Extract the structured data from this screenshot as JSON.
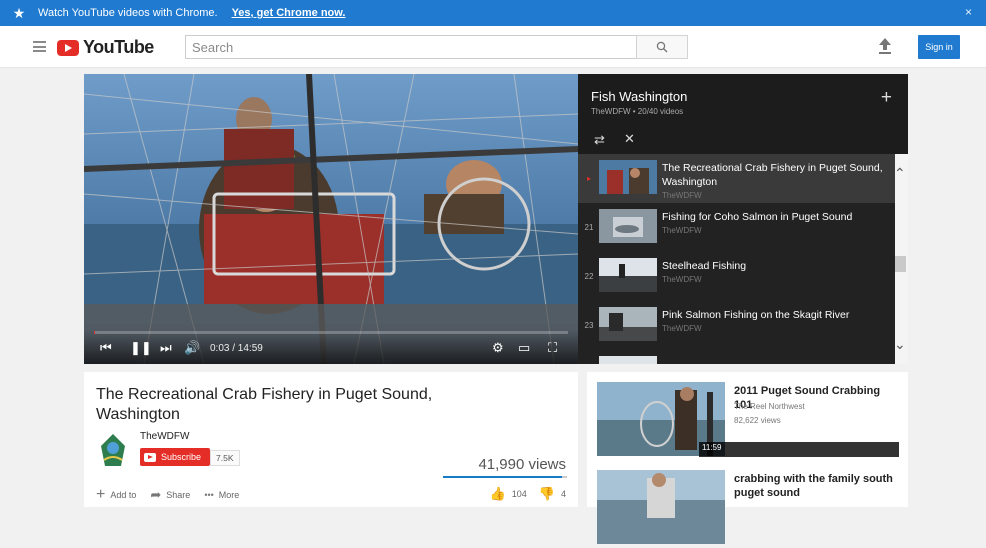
{
  "banner": {
    "message": "Watch YouTube videos with Chrome.",
    "link": "Yes, get Chrome now.",
    "close": "×"
  },
  "header": {
    "logo_text": "YouTube",
    "search_placeholder": "Search",
    "sign_in": "Sign in"
  },
  "player": {
    "time": "0:03 / 14:59",
    "progress": 0.003
  },
  "playlist": {
    "title": "Fish Washington",
    "subtitle": "TheWDFW • 20/40 videos",
    "plus": "+",
    "items": [
      {
        "index": "▸",
        "title": "The Recreational Crab Fishery in Puget Sound, Washington",
        "channel": "TheWDFW",
        "active": true
      },
      {
        "index": "21",
        "title": "Fishing for Coho Salmon in Puget Sound",
        "channel": "TheWDFW",
        "active": false
      },
      {
        "index": "22",
        "title": "Steelhead Fishing",
        "channel": "TheWDFW",
        "active": false
      },
      {
        "index": "23",
        "title": "Pink Salmon Fishing on the Skagit River",
        "channel": "TheWDFW",
        "active": false
      }
    ]
  },
  "video": {
    "title": "The Recreational Crab Fishery in Puget Sound, Washington",
    "channel": "TheWDFW",
    "subscribe": "Subscribe",
    "sub_count": "7.5K",
    "views": "41,990 views",
    "add_to": "Add to",
    "share": "Share",
    "more": "More",
    "likes": "104",
    "dislikes": "4",
    "like_ratio": 0.963
  },
  "related": [
    {
      "title": "2011 Puget Sound Crabbing 101",
      "channel": "The Reel Northwest",
      "views": "82,622 views",
      "duration": "11:59"
    },
    {
      "title": "crabbing with the family south puget sound",
      "channel": "",
      "views": "",
      "duration": ""
    }
  ]
}
